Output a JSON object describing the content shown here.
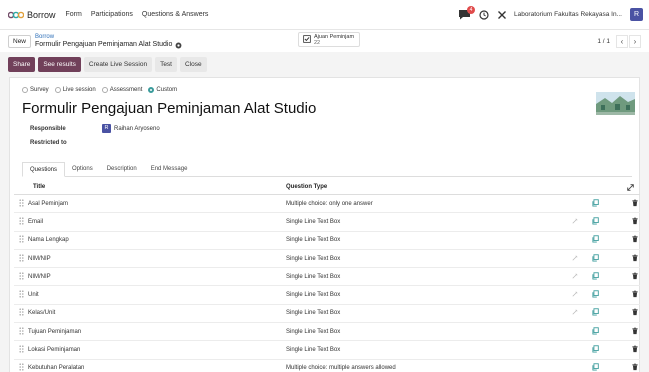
{
  "navbar": {
    "app_name": "Borrow",
    "menus": [
      "Form",
      "Participations",
      "Questions & Answers"
    ],
    "chat_badge": "4",
    "company": "Laboratorium Fakultas Rekayasa In...",
    "user_initial": "R",
    "brand_color": "#71405a"
  },
  "control": {
    "new_label": "New",
    "breadcrumb_parent": "Borrow",
    "breadcrumb_current": "Formulir Pengajuan Peminjaman Alat Studio",
    "smart_label": "Ajuan Peminjam",
    "smart_count": "22",
    "pager": "1 / 1"
  },
  "statusbar": {
    "buttons": [
      "Share",
      "See results",
      "Create Live Session",
      "Test",
      "Close"
    ]
  },
  "form": {
    "survey_types": [
      "Survey",
      "Live session",
      "Assessment",
      "Custom"
    ],
    "selected_type": "Custom",
    "title": "Formulir Pengajuan Peminjaman Alat Studio",
    "responsible_label": "Responsible",
    "responsible_initial": "R",
    "responsible_value": "Raihan Aryoseno",
    "restricted_label": "Restricted to"
  },
  "tabs": [
    "Questions",
    "Options",
    "Description",
    "End Message"
  ],
  "table": {
    "headers": {
      "title": "Title",
      "type": "Question Type"
    },
    "rows": [
      {
        "title": "Asal Peminjam",
        "type": "Multiple choice: only one answer",
        "conditional": false
      },
      {
        "title": "Email",
        "type": "Single Line Text Box",
        "conditional": true
      },
      {
        "title": "Nama Lengkap",
        "type": "Single Line Text Box",
        "conditional": false
      },
      {
        "title": "NIM/NIP",
        "type": "Single Line Text Box",
        "conditional": true
      },
      {
        "title": "NIM/NIP",
        "type": "Single Line Text Box",
        "conditional": true
      },
      {
        "title": "Unit",
        "type": "Single Line Text Box",
        "conditional": true
      },
      {
        "title": "Kelas/Unit",
        "type": "Single Line Text Box",
        "conditional": true
      },
      {
        "title": "Tujuan Peminjaman",
        "type": "Single Line Text Box",
        "conditional": false
      },
      {
        "title": "Lokasi Peminjaman",
        "type": "Single Line Text Box",
        "conditional": false
      },
      {
        "title": "Kebutuhan Peralatan",
        "type": "Multiple choice: multiple answers allowed",
        "conditional": false
      }
    ]
  }
}
